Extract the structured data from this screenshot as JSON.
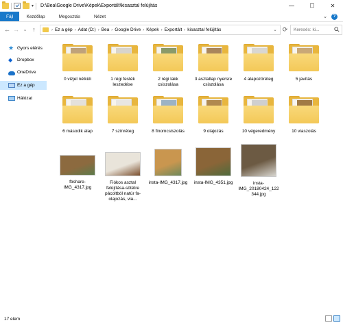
{
  "window": {
    "title": "D:\\Bea\\Google Drive\\Képek\\Exportált\\kisasztal felújítás",
    "minimize": "—",
    "maximize": "☐",
    "close": "✕"
  },
  "ribbon": {
    "tabs": [
      "Fájl",
      "Kezdőlap",
      "Megosztás",
      "Nézet"
    ],
    "expand": "⌄",
    "help": "?"
  },
  "nav": {
    "back": "←",
    "forward": "→",
    "recent": "⌄",
    "up": "↑"
  },
  "address": {
    "crumbs": [
      "Ez a gép",
      "Adat (D:)",
      "Bea",
      "Google Drive",
      "Képek",
      "Exportált",
      "kisasztal felújítás"
    ],
    "separator": "›",
    "dropdown": "⌄",
    "refresh": "⟳"
  },
  "search": {
    "placeholder": "Keresés: ki..."
  },
  "sidebar": {
    "items": [
      {
        "label": "Gyors elérés",
        "icon": "star-icon"
      },
      {
        "label": "Dropbox",
        "icon": "dropbox-icon"
      },
      {
        "label": "OneDrive",
        "icon": "cloud-icon"
      },
      {
        "label": "Ez a gép",
        "icon": "computer-icon",
        "selected": true
      },
      {
        "label": "Hálózat",
        "icon": "network-icon"
      }
    ]
  },
  "folders": [
    {
      "name": "0 vizjel nélküli",
      "photo_color": "#bfa27a"
    },
    {
      "name": "1 régi festék leszedése",
      "photo_color": "#d8d4cc"
    },
    {
      "name": "2 régi lakk csiszolása",
      "photo_color": "#8a9a6a"
    },
    {
      "name": "3 asztallap nyersre csiszolása",
      "photo_color": "#a9865c"
    },
    {
      "name": "4 alapozóréteg",
      "photo_color": "#d9d7d2"
    },
    {
      "name": "5 javítás",
      "photo_color": "#c9a877"
    },
    {
      "name": "6 második alap",
      "photo_color": "#e4e1db"
    },
    {
      "name": "7 színréteg",
      "photo_color": "#e8e6e2"
    },
    {
      "name": "8 finomcsiszolás",
      "photo_color": "#9cb3c4"
    },
    {
      "name": "9 olajozás",
      "photo_color": "#b0894f"
    },
    {
      "name": "10 végeredmény",
      "photo_color": "#cfcfcf"
    },
    {
      "name": "10 viaszolás",
      "photo_color": "#a17a45"
    }
  ],
  "files": [
    {
      "name": "fbshare-IMG_4317.jpg",
      "colors": [
        "#8c6a3f",
        "#5d7a4a"
      ]
    },
    {
      "name": "Fiókos asztal felújítása-sötétre pácoltból natúr fa-olajozás, via...",
      "colors": [
        "#e9e4da",
        "#7a4e2c"
      ]
    },
    {
      "name": "insta-IMG_4317.jpg",
      "colors": [
        "#c9964f",
        "#6f8a5a"
      ]
    },
    {
      "name": "insta-IMG_4351.jpg",
      "colors": [
        "#8a6538",
        "#4f6b3c"
      ]
    },
    {
      "name": "insta-IMG_20180424_122344.jpg",
      "colors": [
        "#6c5a43",
        "#d8d6d0"
      ]
    }
  ],
  "status": {
    "count": "17 elem"
  }
}
